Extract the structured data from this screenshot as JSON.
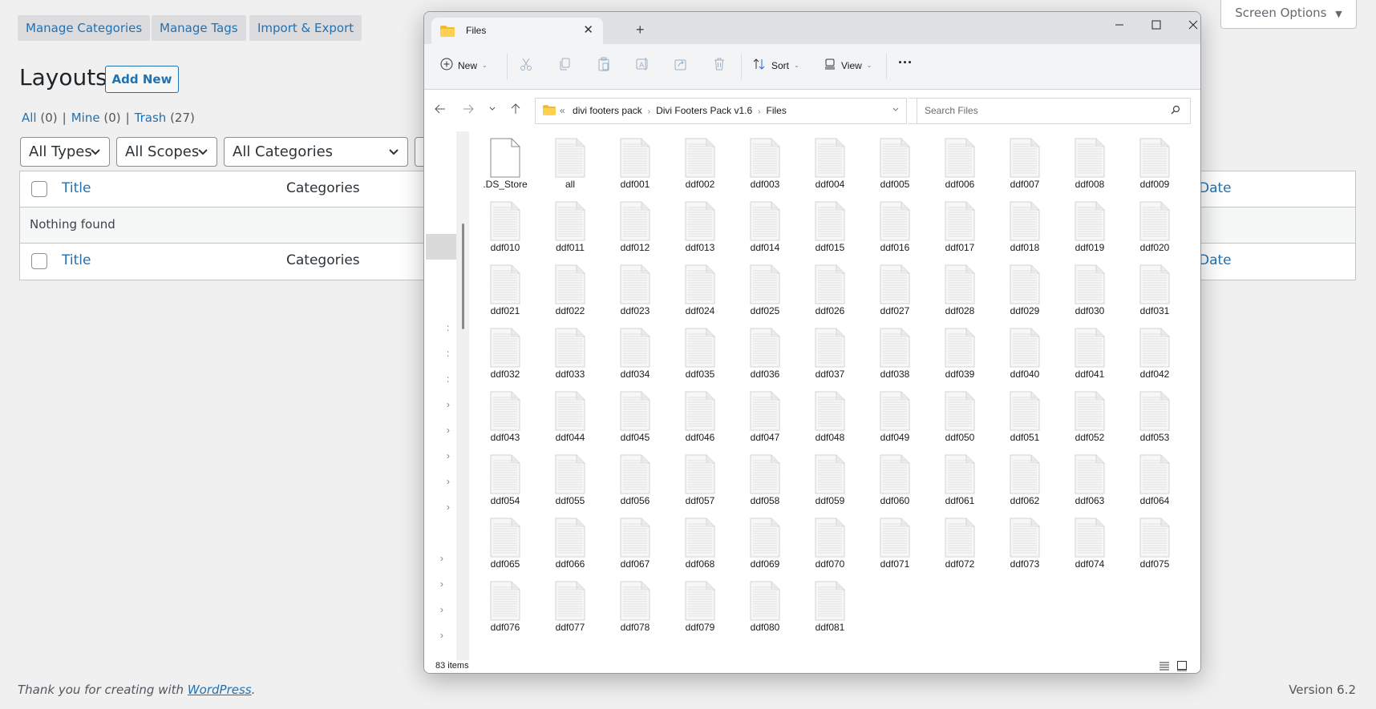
{
  "wp": {
    "top_tabs": [
      {
        "label": "Manage Categories"
      },
      {
        "label": "Manage Tags"
      },
      {
        "label": "Import & Export"
      }
    ],
    "screen_options": "Screen Options",
    "screen_options_arrow": "▼",
    "page_title": "Layouts",
    "add_new": "Add New",
    "views": {
      "all": "All",
      "all_count": "(0)",
      "mine": "Mine",
      "mine_count": "(0)",
      "trash": "Trash",
      "trash_count": "(27)",
      "sep": "|"
    },
    "filters": [
      {
        "selected": "All Types"
      },
      {
        "selected": "All Scopes"
      },
      {
        "selected": "All Categories"
      }
    ],
    "table": {
      "columns": {
        "title": "Title",
        "categories": "Categories",
        "date": "Date"
      },
      "empty_message": "Nothing found"
    },
    "footer": {
      "thanks_prefix": "Thank you for creating with ",
      "wordpress_link": "WordPress",
      "thanks_suffix": ".",
      "version": "Version 6.2"
    }
  },
  "explorer": {
    "tab_title": "Files",
    "icons": {
      "close": "✕",
      "new_tab": "+",
      "minimize": "—",
      "maximize": "☐",
      "window_close": "✕",
      "chevron_right": "›",
      "dropdown": "⌄"
    },
    "toolbar": {
      "new_label": "New",
      "sort_label": "Sort",
      "view_label": "View",
      "more": "···"
    },
    "breadcrumb": {
      "overflow": "«",
      "parts": [
        "divi footers pack",
        "Divi Footers Pack v1.6",
        "Files"
      ]
    },
    "search_placeholder": "Search Files",
    "status": {
      "item_count": "83 items"
    },
    "files": [
      ".DS_Store",
      "all",
      "ddf001",
      "ddf002",
      "ddf003",
      "ddf004",
      "ddf005",
      "ddf006",
      "ddf007",
      "ddf008",
      "ddf009",
      "ddf010",
      "ddf011",
      "ddf012",
      "ddf013",
      "ddf014",
      "ddf015",
      "ddf016",
      "ddf017",
      "ddf018",
      "ddf019",
      "ddf020",
      "ddf021",
      "ddf022",
      "ddf023",
      "ddf024",
      "ddf025",
      "ddf026",
      "ddf027",
      "ddf028",
      "ddf029",
      "ddf030",
      "ddf031",
      "ddf032",
      "ddf033",
      "ddf034",
      "ddf035",
      "ddf036",
      "ddf037",
      "ddf038",
      "ddf039",
      "ddf040",
      "ddf041",
      "ddf042",
      "ddf043",
      "ddf044",
      "ddf045",
      "ddf046",
      "ddf047",
      "ddf048",
      "ddf049",
      "ddf050",
      "ddf051",
      "ddf052",
      "ddf053",
      "ddf054",
      "ddf055",
      "ddf056",
      "ddf057",
      "ddf058",
      "ddf059",
      "ddf060",
      "ddf061",
      "ddf062",
      "ddf063",
      "ddf064",
      "ddf065",
      "ddf066",
      "ddf067",
      "ddf068",
      "ddf069",
      "ddf070",
      "ddf071",
      "ddf072",
      "ddf073",
      "ddf074",
      "ddf075",
      "ddf076",
      "ddf077",
      "ddf078",
      "ddf079",
      "ddf080",
      "ddf081"
    ]
  }
}
